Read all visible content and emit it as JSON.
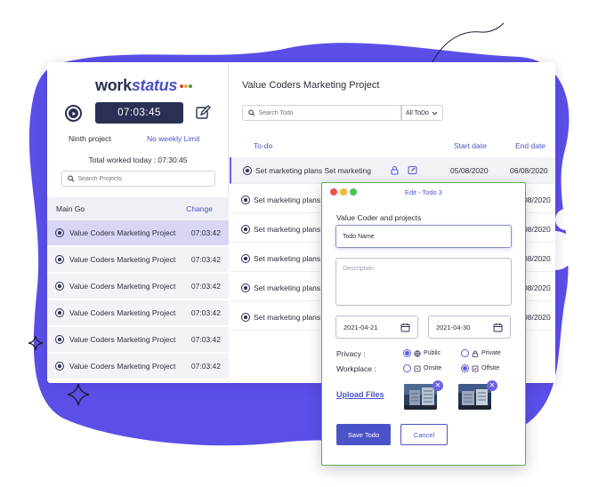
{
  "app": {
    "logo_part1": "work",
    "logo_part2": "status",
    "logo_dot_colors": [
      "#e5423b",
      "#f5a623",
      "#3b9b4a"
    ]
  },
  "timer": {
    "value": "07:03:45",
    "play_icon": "play-icon",
    "edit_icon": "edit-icon"
  },
  "sidebar": {
    "project_name": "Ninth project",
    "weekly_limit": "No weekly Limit",
    "total_worked": "Total worked today : 07:30:45",
    "search_placeholder": "Search Projects",
    "group_label": "Main Go",
    "change_label": "Change",
    "projects": [
      {
        "name": "Value Coders Marketing Project",
        "time": "07:03:42",
        "active": true
      },
      {
        "name": "Value Coders Marketing Project",
        "time": "07:03:42",
        "active": false
      },
      {
        "name": "Value Coders Marketing Project",
        "time": "07:03:42",
        "active": false
      },
      {
        "name": "Value Coders Marketing Project",
        "time": "07:03:42",
        "active": false
      },
      {
        "name": "Value Coders Marketing Project",
        "time": "07:03:42",
        "active": false
      },
      {
        "name": "Value Coders Marketing Project",
        "time": "07:03:42",
        "active": false
      }
    ]
  },
  "main": {
    "title": "Value Coders Marketing Project",
    "search_placeholder": "Search Todo",
    "filter_value": "All ToDo",
    "columns": {
      "todo": "To-do",
      "start": "Start date",
      "end": "End date"
    },
    "todos": [
      {
        "text": "Set marketing plans Set marketing",
        "start": "05/08/2020",
        "end": "06/08/2020"
      },
      {
        "text": "Set marketing plans",
        "start": "",
        "end": "08/2020"
      },
      {
        "text": "Set marketing plans",
        "start": "",
        "end": "08/2020"
      },
      {
        "text": "Set marketing plans",
        "start": "",
        "end": "08/2020"
      },
      {
        "text": "Set marketing plans",
        "start": "",
        "end": "08/2020"
      },
      {
        "text": "Set marketing plans",
        "start": "",
        "end": "08/2020"
      }
    ]
  },
  "dialog": {
    "title": "Edit - Todo 3",
    "project_label": "Value Coder and projects",
    "name_value": "Todo Name",
    "description_placeholder": "Description",
    "start_date": "2021-04-21",
    "end_date": "2021-04-30",
    "privacy_label": "Privacy :",
    "privacy_options": [
      {
        "label": "Public",
        "selected": true
      },
      {
        "label": "Private",
        "selected": false
      }
    ],
    "workplace_label": "Workplace :",
    "workplace_options": [
      {
        "label": "Onsite",
        "selected": false
      },
      {
        "label": "Offsite",
        "selected": true
      }
    ],
    "upload_label": "Upload Files",
    "save_label": "Save Todo",
    "cancel_label": "Cancel",
    "window_dot_colors": [
      "#f0524c",
      "#f7b731",
      "#4cc152"
    ]
  },
  "colors": {
    "accent": "#4b53c8",
    "navy": "#2a3054",
    "blob": "#5b4fe8",
    "selected_row": "#d7d6f4"
  }
}
